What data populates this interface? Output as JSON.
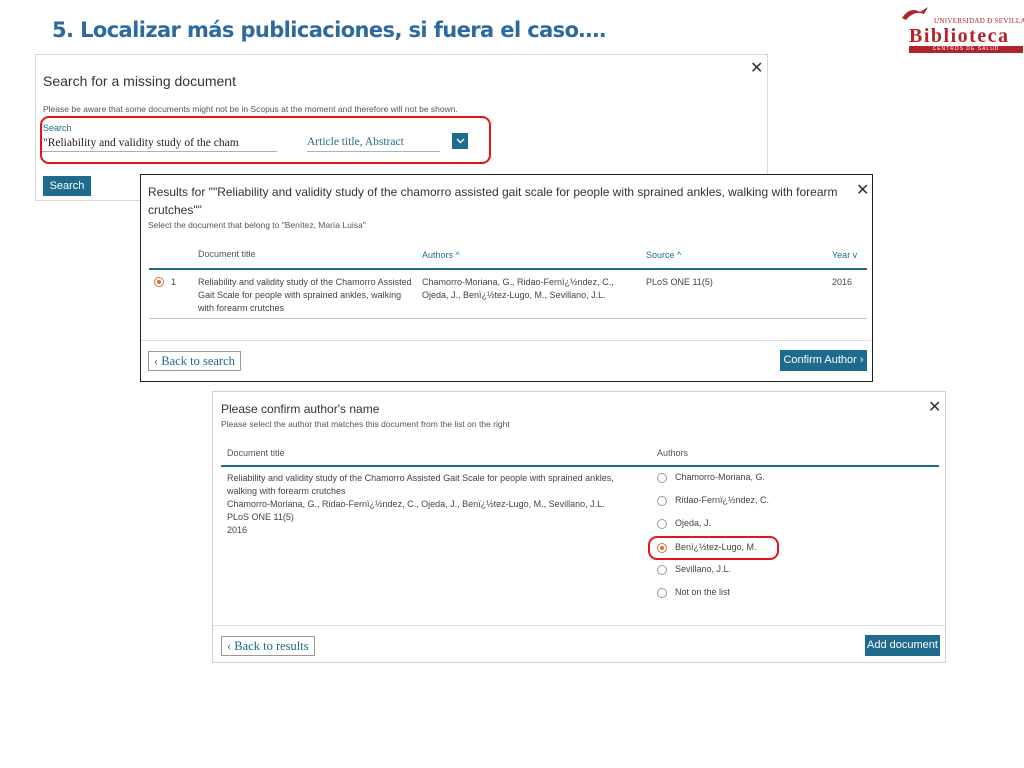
{
  "slide": {
    "title": "5. Localizar más publicaciones, si fuera el caso….",
    "logo": {
      "university": "UNIVERSIDAD Ð SEVILLA",
      "name": "Biblioteca",
      "subtitle": "CENTROS DE SALUD"
    }
  },
  "search_panel": {
    "heading": "Search for a missing document",
    "notice": "Please be aware that some documents might not be in Scopus at the moment and therefore will not be shown.",
    "search_label": "Search",
    "search_value": "\"Reliability and validity study of the cham",
    "field_value": "Article title, Abstract",
    "search_button": "Search",
    "close": "✕"
  },
  "results_panel": {
    "title": "Results for \"\"Reliability and validity study of the chamorro assisted gait scale for people with sprained ankles, walking with forearm crutches\"\"",
    "instruction": "Select the document that belong to \"Benítez, María Luisa\"",
    "columns": {
      "document_title": "Document title",
      "authors": "Authors ^",
      "source": "Source ^",
      "year": "Year v"
    },
    "rows": [
      {
        "index": "1",
        "title": "Reliability and validity study of the Chamorro Assisted Gait Scale for people with sprained ankles, walking with forearm crutches",
        "authors": "Chamorro-Moriana, G., Ridao-Fernï¿½ndez, C., Ojeda, J., Benï¿½tez-Lugo, M., Sevillano, J.L.",
        "source": "PLoS ONE 11(5)",
        "year": "2016",
        "selected": true
      }
    ],
    "back_button": "Back to search",
    "confirm_button": "Confirm Author",
    "close": "✕"
  },
  "confirm_panel": {
    "heading": "Please confirm author's name",
    "instruction": "Please select the author that matches this document from the list on the right",
    "columns": {
      "document_title": "Document title",
      "authors": "Authors"
    },
    "document": {
      "title": "Reliability and validity study of the Chamorro Assisted Gait Scale for people with sprained ankles, walking with forearm crutches",
      "authors": "Chamorro-Moriana, G., Ridao-Fernï¿½ndez, C., Ojeda, J., Benï¿½tez-Lugo, M., Sevillano, J.L.",
      "source": "PLoS ONE 11(5)",
      "year": "2016"
    },
    "author_options": [
      {
        "label": "Chamorro-Moriana, G.",
        "selected": false
      },
      {
        "label": "Ridao-Fernï¿½ndez, C.",
        "selected": false
      },
      {
        "label": "Ojeda, J.",
        "selected": false
      },
      {
        "label": "Benï¿½tez-Lugo, M.",
        "selected": true
      },
      {
        "label": "Sevillano, J.L.",
        "selected": false
      },
      {
        "label": "Not on the list",
        "selected": false
      }
    ],
    "back_button": "Back to results",
    "add_button": "Add document",
    "close": "✕"
  },
  "colors": {
    "accent": "#1f6b8e",
    "title_blue": "#2e6a9e",
    "highlight_red": "#e3141d",
    "logo_red": "#b0252c"
  }
}
